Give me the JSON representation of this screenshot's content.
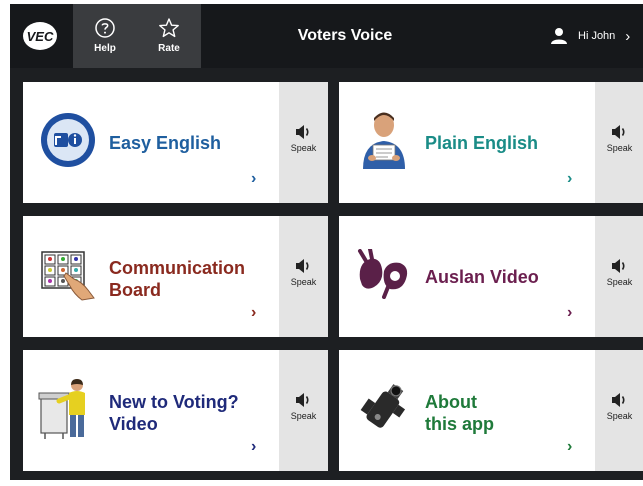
{
  "topbar": {
    "logo_text": "VEC",
    "help_label": "Help",
    "rate_label": "Rate",
    "app_title": "Voters Voice",
    "user_greeting": "Hi John",
    "user_chevron": "›"
  },
  "tiles": [
    {
      "line1": "Easy English",
      "line2": "",
      "color": "#1f5f9f",
      "icon": "easy-english-icon",
      "speak_label": "Speak",
      "chevron": "›"
    },
    {
      "line1": "Plain English",
      "line2": "",
      "color": "#1a8c87",
      "icon": "person-reading-icon",
      "speak_label": "Speak",
      "chevron": "›"
    },
    {
      "line1": "Communication",
      "line2": "Board",
      "color": "#8a2a1f",
      "icon": "communication-board-icon",
      "speak_label": "Speak",
      "chevron": "›"
    },
    {
      "line1": "Auslan Video",
      "line2": "",
      "color": "#6b1f4f",
      "icon": "sign-language-hands-icon",
      "speak_label": "Speak",
      "chevron": "›"
    },
    {
      "line1": "New to Voting?",
      "line2": "Video",
      "color": "#1f2a7a",
      "icon": "voter-at-booth-icon",
      "speak_label": "Speak",
      "chevron": "›"
    },
    {
      "line1": "About",
      "line2": "this app",
      "color": "#1f7a3a",
      "icon": "video-camera-icon",
      "speak_label": "Speak",
      "chevron": "›"
    }
  ],
  "colors": {
    "background": "#1d1f22",
    "topbar": "#16181b",
    "topbar_button": "#3a3c3f",
    "speak_panel": "#e4e4e4"
  }
}
